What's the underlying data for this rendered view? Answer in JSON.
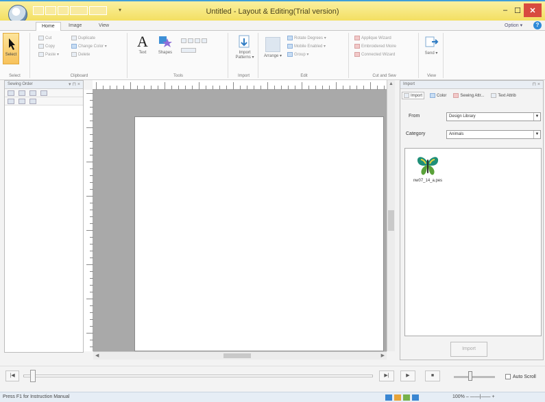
{
  "window": {
    "title": "Untitled - Layout & Editing(Trial version)",
    "controls": {
      "minimize": "–",
      "maximize": "☐",
      "close": "✕"
    }
  },
  "quick_access": {
    "more": "▾"
  },
  "tabs": [
    {
      "label": "Home",
      "active": true
    },
    {
      "label": "Image",
      "active": false
    },
    {
      "label": "View",
      "active": false
    }
  ],
  "options_label": "Option ▾",
  "help_label": "?",
  "ribbon": {
    "select": {
      "label": "Select",
      "group": "Select"
    },
    "clipboard": {
      "group": "Clipboard",
      "items": [
        "Cut",
        "Copy",
        "Paste ▾",
        "Duplicate",
        "Change Color ▾",
        "Delete"
      ]
    },
    "tools": {
      "group": "Tools",
      "text_label": "Text",
      "shapes_label": "Shapes"
    },
    "import": {
      "group": "Import",
      "label": "Import Patterns ▾"
    },
    "edit": {
      "group": "Edit",
      "arrange_label": "Arrange ▾",
      "items": [
        "Rotate Degrees ▾",
        "Mobile Enabled ▾",
        "Group ▾"
      ]
    },
    "cut_sew": {
      "group": "Cut and Sew",
      "items": [
        "Applique Wizard",
        "Embroidered Moire",
        "Connected Wizard"
      ]
    },
    "view": {
      "group": "View",
      "send_label": "Send ▾"
    }
  },
  "left_panel": {
    "title": "Sewing Order",
    "pin": "▾ ⊓ ×"
  },
  "right_panel": {
    "title": "Import",
    "pin": "⊓ ×",
    "tabs": [
      {
        "label": "Import",
        "icon": "import-icon"
      },
      {
        "label": "Color",
        "icon": "color-icon"
      },
      {
        "label": "Sewing Attr...",
        "icon": "sewing-attr-icon"
      },
      {
        "label": "Text Attrib",
        "icon": "text-attr-icon"
      }
    ],
    "from_label": "From",
    "from_value": "Design Library",
    "category_label": "Category",
    "category_value": "Animals",
    "thumbnail": {
      "caption": "nw07_14_a.pes",
      "icon": "butterfly-icon"
    },
    "import_button": "Import"
  },
  "playback": {
    "start": "|◀",
    "step_end": "▶|",
    "play": "▶",
    "stop": "■",
    "progress": 0.02,
    "speed": 0.4,
    "auto_scroll_label": "Auto Scroll"
  },
  "status": {
    "text": "Press F1 for Instruction Manual",
    "zoom": "100%",
    "zoom_controls": "–  ——|——  +"
  }
}
